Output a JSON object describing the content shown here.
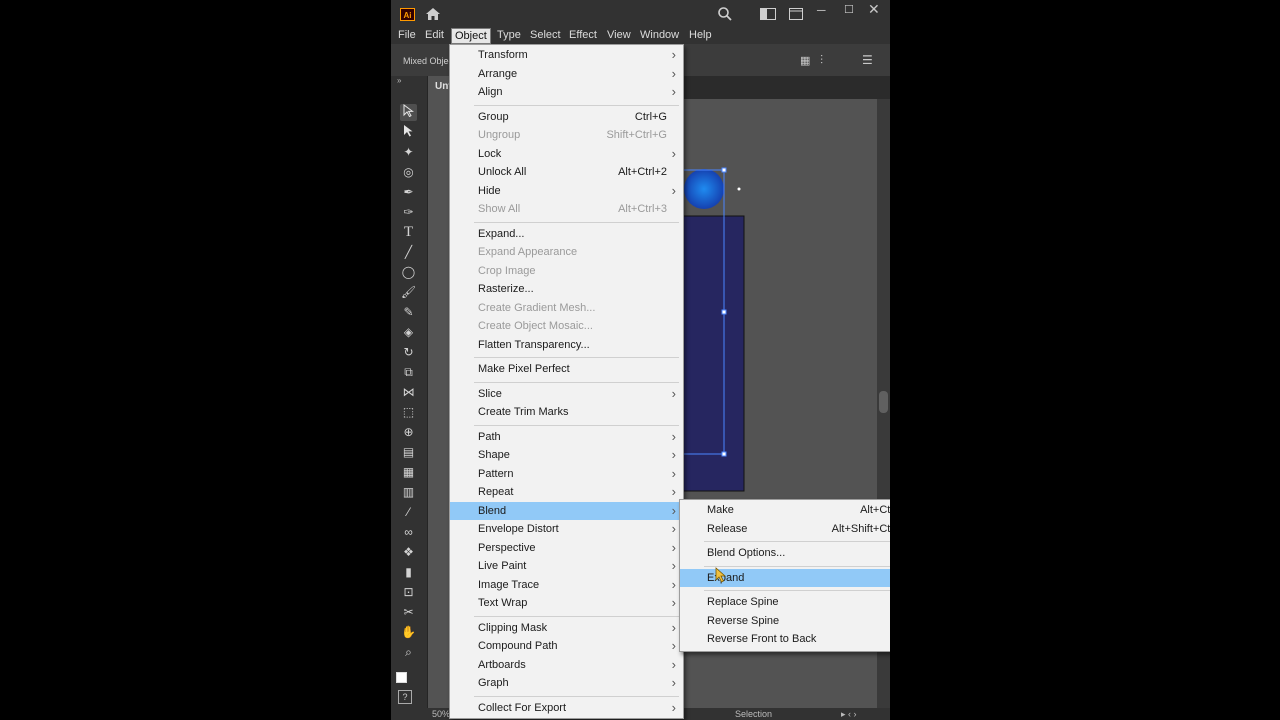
{
  "window": {
    "app_icon": "Ai",
    "doc_tab": "Unt",
    "property_label": "Mixed Objec",
    "zoom": "50%",
    "status_tool": "Selection"
  },
  "menubar": [
    "File",
    "Edit",
    "Object",
    "Type",
    "Select",
    "Effect",
    "View",
    "Window",
    "Help"
  ],
  "object_menu": [
    {
      "label": "Transform",
      "submenu": true
    },
    {
      "label": "Arrange",
      "submenu": true
    },
    {
      "label": "Align",
      "submenu": true
    },
    {
      "sep": true
    },
    {
      "label": "Group",
      "shortcut": "Ctrl+G"
    },
    {
      "label": "Ungroup",
      "shortcut": "Shift+Ctrl+G",
      "disabled": true
    },
    {
      "label": "Lock",
      "submenu": true
    },
    {
      "label": "Unlock All",
      "shortcut": "Alt+Ctrl+2"
    },
    {
      "label": "Hide",
      "submenu": true
    },
    {
      "label": "Show All",
      "shortcut": "Alt+Ctrl+3",
      "disabled": true
    },
    {
      "sep": true
    },
    {
      "label": "Expand..."
    },
    {
      "label": "Expand Appearance",
      "disabled": true
    },
    {
      "label": "Crop Image",
      "disabled": true
    },
    {
      "label": "Rasterize..."
    },
    {
      "label": "Create Gradient Mesh...",
      "disabled": true
    },
    {
      "label": "Create Object Mosaic...",
      "disabled": true
    },
    {
      "label": "Flatten Transparency..."
    },
    {
      "sep": true
    },
    {
      "label": "Make Pixel Perfect"
    },
    {
      "sep": true
    },
    {
      "label": "Slice",
      "submenu": true
    },
    {
      "label": "Create Trim Marks"
    },
    {
      "sep": true
    },
    {
      "label": "Path",
      "submenu": true
    },
    {
      "label": "Shape",
      "submenu": true
    },
    {
      "label": "Pattern",
      "submenu": true
    },
    {
      "label": "Repeat",
      "submenu": true
    },
    {
      "label": "Blend",
      "submenu": true,
      "highlighted": true
    },
    {
      "label": "Envelope Distort",
      "submenu": true
    },
    {
      "label": "Perspective",
      "submenu": true
    },
    {
      "label": "Live Paint",
      "submenu": true
    },
    {
      "label": "Image Trace",
      "submenu": true
    },
    {
      "label": "Text Wrap",
      "submenu": true
    },
    {
      "sep": true
    },
    {
      "label": "Clipping Mask",
      "submenu": true
    },
    {
      "label": "Compound Path",
      "submenu": true
    },
    {
      "label": "Artboards",
      "submenu": true
    },
    {
      "label": "Graph",
      "submenu": true
    },
    {
      "sep": true
    },
    {
      "label": "Collect For Export",
      "submenu": true
    }
  ],
  "blend_submenu": [
    {
      "label": "Make",
      "shortcut": "Alt+Ctr"
    },
    {
      "label": "Release",
      "shortcut": "Alt+Shift+Ctr"
    },
    {
      "sep": true
    },
    {
      "label": "Blend Options..."
    },
    {
      "sep": true
    },
    {
      "label": "Expand",
      "highlighted": true
    },
    {
      "sep": true
    },
    {
      "label": "Replace Spine"
    },
    {
      "label": "Reverse Spine"
    },
    {
      "label": "Reverse Front to Back"
    }
  ],
  "colors": {
    "menu_highlight": "#91c9f7",
    "app_bg": "#323232",
    "canvas": "#535353",
    "rect_fill": "#262660",
    "circle_fill": "#1a7be0",
    "selection": "#4b86ff"
  }
}
